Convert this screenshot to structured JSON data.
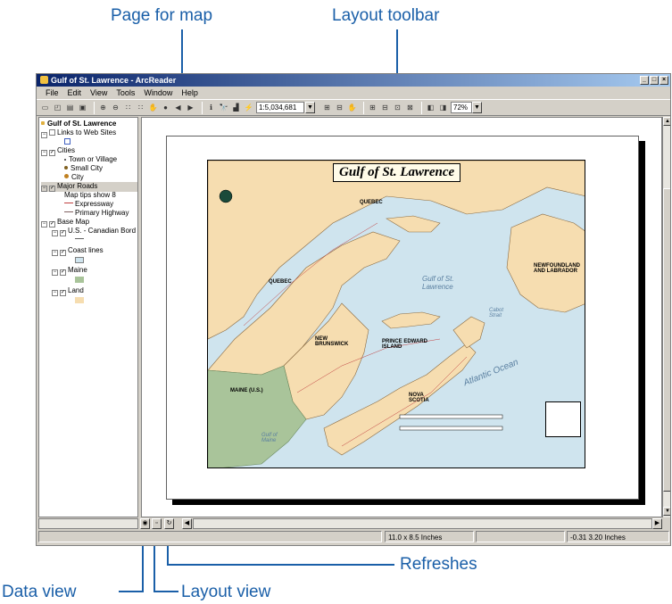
{
  "callouts": {
    "page_for_map": "Page for map",
    "layout_toolbar": "Layout toolbar",
    "refreshes": "Refreshes",
    "data_view": "Data view",
    "layout_view": "Layout view"
  },
  "window": {
    "title": "Gulf of St. Lawrence - ArcReader"
  },
  "menu": [
    "File",
    "Edit",
    "View",
    "Tools",
    "Window",
    "Help"
  ],
  "toolbar": {
    "scale_value": "1:5,034,681",
    "zoom_value": "72%"
  },
  "toc": {
    "root": "Gulf of St. Lawrence",
    "links": "Links to Web Sites",
    "cities": "Cities",
    "town": "Town or Village",
    "small_city": "Small City",
    "city": "City",
    "major_roads": "Major Roads",
    "map_tips": "Map tips show 8",
    "expressway": "Expressway",
    "primary_highway": "Primary Highway",
    "base_map": "Base Map",
    "us_canadian": "U.S. - Canadian Bord",
    "coast_lines": "Coast lines",
    "maine": "Maine",
    "land": "Land"
  },
  "map": {
    "title": "Gulf of St. Lawrence",
    "labels": {
      "quebec_north": "QUEBEC",
      "quebec": "QUEBEC",
      "newfoundland": "NEWFOUNDLAND AND LABRADOR",
      "new_brunswick": "NEW BRUNSWICK",
      "pei": "PRINCE EDWARD ISLAND",
      "maine": "MAINE (U.S.)",
      "nova_scotia": "NOVA SCOTIA",
      "gulf": "Gulf of St. Lawrence",
      "atlantic": "Atlantic Ocean",
      "gulf_of_maine": "Gulf of Maine",
      "cabot_strait": "Cabot Strait"
    }
  },
  "status": {
    "page_size": "11.0 x 8.5 Inches",
    "coords": "-0.31  3.20 Inches"
  },
  "colors": {
    "callout": "#1a5fa8",
    "land": "#f6ddb0",
    "water": "#cfe4ee",
    "maine": "#a9c49a",
    "titlebar": "#0a246a"
  }
}
